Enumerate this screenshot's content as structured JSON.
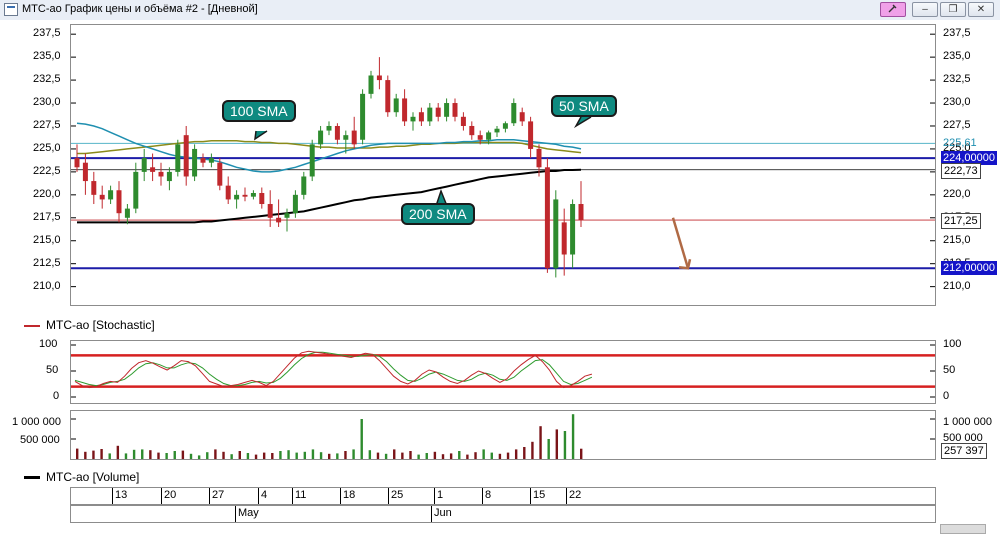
{
  "window": {
    "title": "МТС-ао График цены и объёма #2 - [Дневной]",
    "minimize_label": "–",
    "restore_label": "❐",
    "close_label": "✕"
  },
  "price_pane": {
    "y_ticks": [
      "237,5",
      "235,0",
      "232,5",
      "230,0",
      "227,5",
      "225,0",
      "222,5",
      "220,0",
      "217,5",
      "215,0",
      "212,5",
      "210,0"
    ],
    "tags": {
      "sma100": "225,61",
      "level_high": "224,00000",
      "sma200": "222,73",
      "last_price": "217,25",
      "level_low": "212,00000"
    },
    "callouts": {
      "sma100": "100 SMA",
      "sma50": "50 SMA",
      "sma200": "200 SMA"
    }
  },
  "stoch_pane": {
    "legend": "МТС-ао [Stochastic]",
    "y_ticks": [
      "100",
      "50",
      "0"
    ]
  },
  "volume_pane": {
    "left_ticks": [
      "1 000 000",
      "500 000"
    ],
    "right_ticks": [
      "1 000 000",
      "500 000"
    ],
    "last_volume": "257 397"
  },
  "volume_legend": "МТС-ао [Volume]",
  "date_axis": {
    "days": [
      "13",
      "20",
      "27",
      "4",
      "11",
      "18",
      "25",
      "1",
      "8",
      "15",
      "22"
    ],
    "months": [
      "May",
      "Jun"
    ]
  },
  "colors": {
    "bull": "#2e8b2e",
    "bear": "#c0282d",
    "sma50": "#1f8fb0",
    "sma100": "#8b8b1a",
    "sma200": "#000000",
    "level": "#1c1ca8",
    "callout": "#0f8a80",
    "level_tag": "#1414c8",
    "stoch_band": "#d62020"
  },
  "chart_data": {
    "type": "candlestick",
    "ylim": [
      208.0,
      238.5
    ],
    "candles": [
      {
        "o": 224.0,
        "h": 225.5,
        "l": 222.5,
        "c": 223.0
      },
      {
        "o": 223.5,
        "h": 224.5,
        "l": 220.0,
        "c": 221.5
      },
      {
        "o": 221.5,
        "h": 222.5,
        "l": 219.0,
        "c": 220.0
      },
      {
        "o": 220.0,
        "h": 221.0,
        "l": 218.5,
        "c": 219.5
      },
      {
        "o": 219.5,
        "h": 221.0,
        "l": 219.0,
        "c": 220.5
      },
      {
        "o": 220.5,
        "h": 221.5,
        "l": 217.0,
        "c": 218.0
      },
      {
        "o": 217.5,
        "h": 219.0,
        "l": 216.8,
        "c": 218.5
      },
      {
        "o": 218.5,
        "h": 223.5,
        "l": 218.0,
        "c": 222.5
      },
      {
        "o": 222.5,
        "h": 225.0,
        "l": 221.5,
        "c": 224.0
      },
      {
        "o": 223.0,
        "h": 224.5,
        "l": 221.5,
        "c": 222.5
      },
      {
        "o": 222.5,
        "h": 223.5,
        "l": 221.0,
        "c": 222.0
      },
      {
        "o": 221.5,
        "h": 223.0,
        "l": 220.5,
        "c": 222.5
      },
      {
        "o": 222.5,
        "h": 226.0,
        "l": 222.0,
        "c": 225.5
      },
      {
        "o": 226.5,
        "h": 227.5,
        "l": 221.0,
        "c": 222.0
      },
      {
        "o": 222.0,
        "h": 225.5,
        "l": 221.5,
        "c": 225.0
      },
      {
        "o": 224.0,
        "h": 224.5,
        "l": 223.0,
        "c": 223.5
      },
      {
        "o": 223.5,
        "h": 224.5,
        "l": 223.0,
        "c": 224.0
      },
      {
        "o": 223.5,
        "h": 224.0,
        "l": 220.5,
        "c": 221.0
      },
      {
        "o": 221.0,
        "h": 222.0,
        "l": 219.0,
        "c": 219.5
      },
      {
        "o": 219.5,
        "h": 220.5,
        "l": 218.5,
        "c": 220.0
      },
      {
        "o": 220.0,
        "h": 220.8,
        "l": 219.3,
        "c": 219.8
      },
      {
        "o": 219.8,
        "h": 220.5,
        "l": 219.5,
        "c": 220.2
      },
      {
        "o": 220.2,
        "h": 220.8,
        "l": 218.5,
        "c": 219.0
      },
      {
        "o": 219.0,
        "h": 220.5,
        "l": 216.5,
        "c": 217.5
      },
      {
        "o": 217.5,
        "h": 219.5,
        "l": 216.5,
        "c": 217.0
      },
      {
        "o": 217.5,
        "h": 218.5,
        "l": 216.0,
        "c": 218.0
      },
      {
        "o": 218.0,
        "h": 220.5,
        "l": 217.5,
        "c": 220.0
      },
      {
        "o": 220.0,
        "h": 222.5,
        "l": 219.5,
        "c": 222.0
      },
      {
        "o": 222.0,
        "h": 226.0,
        "l": 221.5,
        "c": 225.5
      },
      {
        "o": 225.5,
        "h": 227.5,
        "l": 225.0,
        "c": 227.0
      },
      {
        "o": 227.0,
        "h": 228.0,
        "l": 226.5,
        "c": 227.5
      },
      {
        "o": 227.5,
        "h": 227.8,
        "l": 225.5,
        "c": 226.0
      },
      {
        "o": 226.0,
        "h": 227.0,
        "l": 224.5,
        "c": 226.5
      },
      {
        "o": 227.0,
        "h": 228.5,
        "l": 225.0,
        "c": 225.5
      },
      {
        "o": 226.0,
        "h": 231.5,
        "l": 225.5,
        "c": 231.0
      },
      {
        "o": 231.0,
        "h": 233.5,
        "l": 230.5,
        "c": 233.0
      },
      {
        "o": 233.0,
        "h": 235.0,
        "l": 231.5,
        "c": 232.5
      },
      {
        "o": 232.5,
        "h": 233.0,
        "l": 228.5,
        "c": 229.0
      },
      {
        "o": 229.0,
        "h": 231.0,
        "l": 228.5,
        "c": 230.5
      },
      {
        "o": 230.5,
        "h": 231.5,
        "l": 227.5,
        "c": 228.0
      },
      {
        "o": 228.0,
        "h": 229.0,
        "l": 227.0,
        "c": 228.5
      },
      {
        "o": 229.0,
        "h": 229.5,
        "l": 227.5,
        "c": 228.0
      },
      {
        "o": 228.0,
        "h": 230.0,
        "l": 227.5,
        "c": 229.5
      },
      {
        "o": 229.5,
        "h": 230.0,
        "l": 228.0,
        "c": 228.5
      },
      {
        "o": 228.5,
        "h": 230.5,
        "l": 228.0,
        "c": 230.0
      },
      {
        "o": 230.0,
        "h": 230.5,
        "l": 228.0,
        "c": 228.5
      },
      {
        "o": 228.5,
        "h": 229.0,
        "l": 227.0,
        "c": 227.5
      },
      {
        "o": 227.5,
        "h": 228.0,
        "l": 226.0,
        "c": 226.5
      },
      {
        "o": 226.5,
        "h": 227.0,
        "l": 225.5,
        "c": 226.0
      },
      {
        "o": 226.0,
        "h": 227.0,
        "l": 225.5,
        "c": 226.8
      },
      {
        "o": 226.8,
        "h": 227.5,
        "l": 226.3,
        "c": 227.2
      },
      {
        "o": 227.2,
        "h": 228.0,
        "l": 226.8,
        "c": 227.8
      },
      {
        "o": 227.8,
        "h": 230.5,
        "l": 227.5,
        "c": 230.0
      },
      {
        "o": 229.0,
        "h": 229.5,
        "l": 227.5,
        "c": 228.0
      },
      {
        "o": 228.0,
        "h": 228.5,
        "l": 224.0,
        "c": 225.0
      },
      {
        "o": 225.0,
        "h": 225.5,
        "l": 222.0,
        "c": 223.0
      },
      {
        "o": 223.0,
        "h": 224.0,
        "l": 211.5,
        "c": 212.0
      },
      {
        "o": 212.0,
        "h": 220.5,
        "l": 211.0,
        "c": 219.5
      },
      {
        "o": 217.0,
        "h": 218.5,
        "l": 211.2,
        "c": 213.5
      },
      {
        "o": 213.5,
        "h": 219.5,
        "l": 212.0,
        "c": 219.0
      },
      {
        "o": 219.0,
        "h": 221.5,
        "l": 216.5,
        "c": 217.25
      }
    ],
    "sma50": [
      227.8,
      227.7,
      227.5,
      227.2,
      226.8,
      226.4,
      226.0,
      225.6,
      225.3,
      225.0,
      224.7,
      224.4,
      224.2,
      224.1,
      224.0,
      223.9,
      223.8,
      223.6,
      223.3,
      223.0,
      222.8,
      222.6,
      222.5,
      222.5,
      222.6,
      222.8,
      223.0,
      223.3,
      223.6,
      223.9,
      224.2,
      224.5,
      224.8,
      225.0,
      225.2,
      225.4,
      225.5,
      225.6,
      225.6,
      225.6,
      225.6,
      225.6,
      225.6,
      225.6,
      225.7,
      225.7,
      225.8,
      225.8,
      225.9,
      225.9,
      226.0,
      226.0,
      226.0,
      225.9,
      225.8,
      225.7,
      225.6,
      225.5,
      225.3,
      225.2,
      225.0
    ],
    "sma100": [
      224.5,
      224.5,
      224.6,
      224.7,
      224.8,
      224.9,
      225.0,
      225.1,
      225.2,
      225.3,
      225.4,
      225.5,
      225.6,
      225.7,
      225.8,
      225.8,
      225.9,
      225.9,
      225.9,
      225.9,
      225.8,
      225.8,
      225.7,
      225.7,
      225.6,
      225.6,
      225.5,
      225.4,
      225.3,
      225.2,
      225.2,
      225.1,
      225.1,
      225.1,
      225.1,
      225.1,
      225.2,
      225.2,
      225.3,
      225.3,
      225.4,
      225.5,
      225.5,
      225.6,
      225.6,
      225.6,
      225.7,
      225.7,
      225.7,
      225.7,
      225.7,
      225.7,
      225.7,
      225.6,
      225.4,
      225.2,
      225.0,
      224.9,
      224.8,
      224.7,
      224.6
    ],
    "sma200": [
      217.0,
      217.0,
      217.0,
      217.0,
      217.0,
      217.0,
      217.0,
      217.0,
      217.0,
      217.0,
      217.0,
      217.0,
      217.0,
      217.0,
      217.0,
      217.1,
      217.1,
      217.2,
      217.3,
      217.4,
      217.5,
      217.6,
      217.7,
      217.8,
      217.9,
      218.0,
      218.1,
      218.2,
      218.4,
      218.6,
      218.8,
      219.0,
      219.2,
      219.4,
      219.5,
      219.7,
      219.8,
      219.9,
      220.0,
      220.1,
      220.2,
      220.3,
      220.5,
      220.7,
      220.9,
      221.1,
      221.3,
      221.5,
      221.7,
      221.9,
      222.0,
      222.1,
      222.2,
      222.3,
      222.4,
      222.5,
      222.6,
      222.6,
      222.7,
      222.7,
      222.73
    ],
    "levels": [
      224.0,
      212.0
    ],
    "stochastic": {
      "ylim": [
        0,
        100
      ],
      "bands": [
        80,
        20
      ],
      "k": [
        30,
        22,
        18,
        20,
        26,
        30,
        28,
        40,
        55,
        66,
        70,
        65,
        58,
        52,
        60,
        70,
        68,
        60,
        45,
        30,
        25,
        20,
        22,
        24,
        28,
        32,
        28,
        22,
        30,
        45,
        60,
        75,
        85,
        88,
        86,
        84,
        82,
        80,
        78,
        76,
        80,
        84,
        82,
        70,
        55,
        40,
        30,
        25,
        32,
        44,
        52,
        48,
        38,
        30,
        26,
        32,
        42,
        50,
        45,
        36,
        28,
        35,
        50,
        62,
        72,
        80,
        68,
        52,
        30,
        18,
        22,
        30,
        40,
        44
      ],
      "d": [
        32,
        28,
        24,
        22,
        24,
        28,
        30,
        34,
        44,
        56,
        64,
        66,
        62,
        56,
        56,
        62,
        66,
        64,
        56,
        44,
        34,
        26,
        22,
        22,
        24,
        28,
        30,
        27,
        28,
        36,
        48,
        62,
        74,
        82,
        86,
        86,
        84,
        82,
        80,
        78,
        78,
        80,
        82,
        78,
        68,
        54,
        42,
        32,
        30,
        36,
        44,
        48,
        44,
        38,
        32,
        30,
        34,
        42,
        46,
        42,
        34,
        32,
        38,
        50,
        60,
        70,
        72,
        62,
        46,
        30,
        24,
        26,
        32,
        38
      ]
    },
    "volume": {
      "ylim": [
        0,
        1150000
      ],
      "bars": [
        {
          "v": 260000,
          "up": false
        },
        {
          "v": 180000,
          "up": false
        },
        {
          "v": 210000,
          "up": false
        },
        {
          "v": 250000,
          "up": false
        },
        {
          "v": 140000,
          "up": true
        },
        {
          "v": 330000,
          "up": false
        },
        {
          "v": 140000,
          "up": true
        },
        {
          "v": 230000,
          "up": true
        },
        {
          "v": 240000,
          "up": true
        },
        {
          "v": 220000,
          "up": false
        },
        {
          "v": 160000,
          "up": false
        },
        {
          "v": 150000,
          "up": true
        },
        {
          "v": 200000,
          "up": true
        },
        {
          "v": 210000,
          "up": false
        },
        {
          "v": 130000,
          "up": true
        },
        {
          "v": 90000,
          "up": true
        },
        {
          "v": 170000,
          "up": true
        },
        {
          "v": 240000,
          "up": false
        },
        {
          "v": 180000,
          "up": false
        },
        {
          "v": 120000,
          "up": true
        },
        {
          "v": 200000,
          "up": false
        },
        {
          "v": 150000,
          "up": true
        },
        {
          "v": 110000,
          "up": false
        },
        {
          "v": 160000,
          "up": false
        },
        {
          "v": 150000,
          "up": false
        },
        {
          "v": 200000,
          "up": true
        },
        {
          "v": 220000,
          "up": true
        },
        {
          "v": 160000,
          "up": true
        },
        {
          "v": 180000,
          "up": true
        },
        {
          "v": 240000,
          "up": true
        },
        {
          "v": 170000,
          "up": true
        },
        {
          "v": 130000,
          "up": false
        },
        {
          "v": 140000,
          "up": true
        },
        {
          "v": 200000,
          "up": false
        },
        {
          "v": 240000,
          "up": true
        },
        {
          "v": 1000000,
          "up": true
        },
        {
          "v": 220000,
          "up": true
        },
        {
          "v": 160000,
          "up": false
        },
        {
          "v": 130000,
          "up": true
        },
        {
          "v": 240000,
          "up": false
        },
        {
          "v": 160000,
          "up": false
        },
        {
          "v": 200000,
          "up": false
        },
        {
          "v": 110000,
          "up": true
        },
        {
          "v": 150000,
          "up": true
        },
        {
          "v": 180000,
          "up": false
        },
        {
          "v": 120000,
          "up": false
        },
        {
          "v": 140000,
          "up": false
        },
        {
          "v": 200000,
          "up": true
        },
        {
          "v": 110000,
          "up": false
        },
        {
          "v": 170000,
          "up": false
        },
        {
          "v": 240000,
          "up": true
        },
        {
          "v": 160000,
          "up": true
        },
        {
          "v": 130000,
          "up": false
        },
        {
          "v": 160000,
          "up": false
        },
        {
          "v": 240000,
          "up": false
        },
        {
          "v": 300000,
          "up": false
        },
        {
          "v": 430000,
          "up": false
        },
        {
          "v": 820000,
          "up": false
        },
        {
          "v": 500000,
          "up": true
        },
        {
          "v": 740000,
          "up": false
        },
        {
          "v": 700000,
          "up": true
        },
        {
          "v": 1120000,
          "up": true
        },
        {
          "v": 257397,
          "up": false
        }
      ]
    }
  }
}
